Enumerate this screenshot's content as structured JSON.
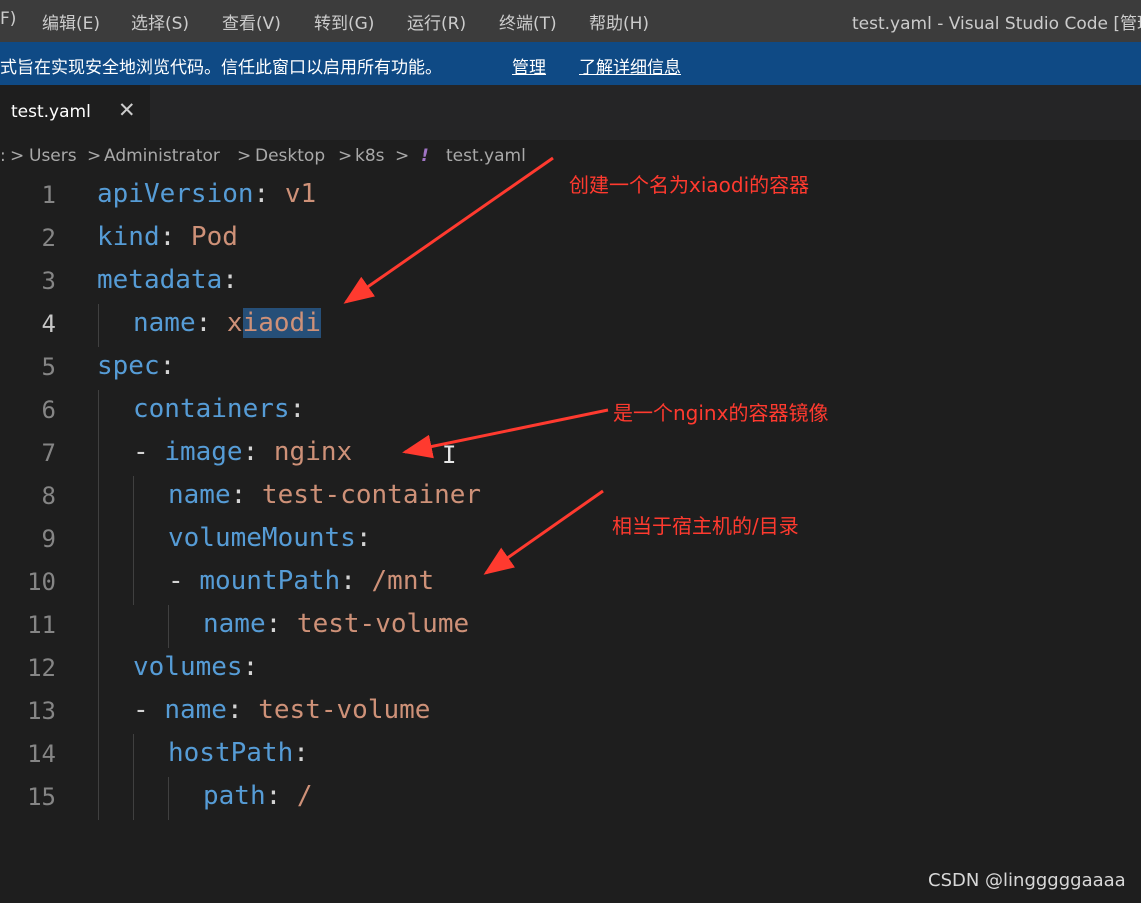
{
  "menubar": {
    "items": [
      "F)",
      "编辑(E)",
      "选择(S)",
      "查看(V)",
      "转到(G)",
      "运行(R)",
      "终端(T)",
      "帮助(H)"
    ],
    "window_title": "test.yaml - Visual Studio Code [管理"
  },
  "banner": {
    "message": "式旨在实现安全地浏览代码。信任此窗口以启用所有功能。",
    "manage_link": "管理",
    "learn_more_link": "了解详细信息"
  },
  "tab": {
    "label": "test.yaml",
    "close_glyph": "✕"
  },
  "breadcrumb": {
    "items": [
      ": ",
      "Users",
      "Administrator",
      "Desktop",
      "k8s",
      "test.yaml"
    ],
    "separator": ">",
    "yaml_icon": "!"
  },
  "editor": {
    "active_line": 4,
    "lines": [
      {
        "num": "1",
        "key": "apiVersion",
        "colon": ":",
        "value": " v1"
      },
      {
        "num": "2",
        "key": "kind",
        "colon": ":",
        "value": " Pod"
      },
      {
        "num": "3",
        "key": "metadata",
        "colon": ":",
        "value": ""
      },
      {
        "num": "4",
        "key": "name",
        "colon": ":",
        "value_pre": " x",
        "value_sel": "iaodi"
      },
      {
        "num": "5",
        "key": "spec",
        "colon": ":",
        "value": ""
      },
      {
        "num": "6",
        "key": "containers",
        "colon": ":",
        "value": ""
      },
      {
        "num": "7",
        "dash": "- ",
        "key": "image",
        "colon": ":",
        "value": " nginx"
      },
      {
        "num": "8",
        "key": "name",
        "colon": ":",
        "value": " test-container"
      },
      {
        "num": "9",
        "key": "volumeMounts",
        "colon": ":",
        "value": ""
      },
      {
        "num": "10",
        "dash": "- ",
        "key": "mountPath",
        "colon": ":",
        "value": " /mnt"
      },
      {
        "num": "11",
        "key": "name",
        "colon": ":",
        "value": " test-volume"
      },
      {
        "num": "12",
        "key": "volumes",
        "colon": ":",
        "value": ""
      },
      {
        "num": "13",
        "dash": "- ",
        "key": "name",
        "colon": ":",
        "value": " test-volume"
      },
      {
        "num": "14",
        "key": "hostPath",
        "colon": ":",
        "value": ""
      },
      {
        "num": "15",
        "key": "path",
        "colon": ":",
        "value": " /"
      }
    ]
  },
  "annotations": [
    "创建一个名为xiaodi的容器",
    "是一个nginx的容器镜像",
    "相当于宿主机的/目录"
  ],
  "annotation_color": "#ff3a2f",
  "watermark": "CSDN @lingggggaaaa"
}
